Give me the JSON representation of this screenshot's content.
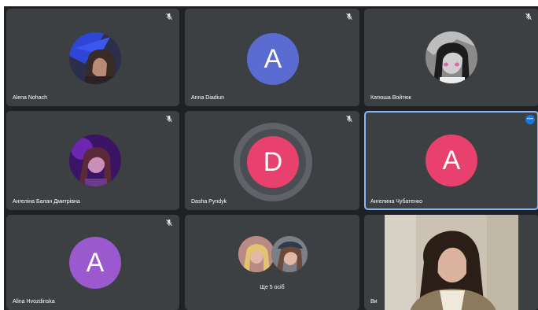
{
  "colors": {
    "background": "#1f2124",
    "tile": "#3c4043",
    "active_border": "#8ab4f8",
    "avatar_anna": "#5a6bd1",
    "avatar_red": "#e8416d",
    "avatar_purple": "#9b59d0",
    "menu_button": "#1a73e8"
  },
  "icons": {
    "mic": "mic-off-icon",
    "more": "more-options-icon"
  },
  "tiles": [
    {
      "name": "Alena Nohach"
    },
    {
      "name": "Anna Diadiun",
      "avatar_letter": "A"
    },
    {
      "name": "Катюша Войтюк"
    },
    {
      "name": "Ангеліна Балан Дмитрівна"
    },
    {
      "name": "Dasha Pyndyk",
      "avatar_letter": "D"
    },
    {
      "name": "Ангелина Чубатенко",
      "avatar_letter": "A"
    },
    {
      "name": "Alina Hvozdinska",
      "avatar_letter": "A"
    },
    {
      "more_label": "Ще 5 осіб"
    },
    {
      "name": "Ви"
    }
  ]
}
